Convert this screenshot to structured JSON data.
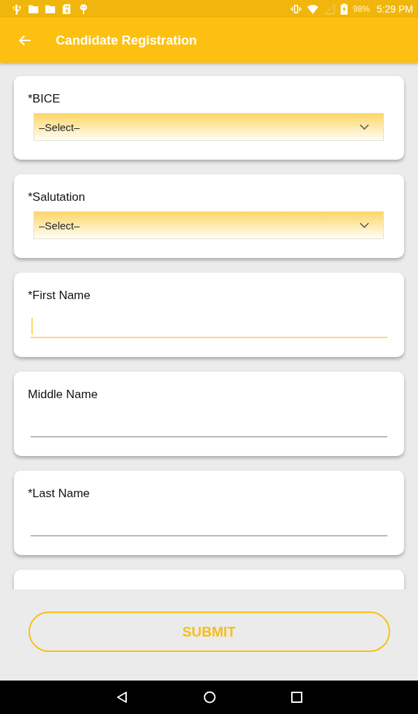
{
  "status_bar": {
    "battery": "98%",
    "time": "5:29 PM"
  },
  "app_bar": {
    "title": "Candidate Registration"
  },
  "fields": [
    {
      "kind": "select",
      "label": "*BICE",
      "value": "–Select–"
    },
    {
      "kind": "select",
      "label": "*Salutation",
      "value": "–Select–"
    },
    {
      "kind": "text",
      "label": "*First Name",
      "focused": true
    },
    {
      "kind": "text",
      "label": "Middle Name",
      "focused": false
    },
    {
      "kind": "text",
      "label": "*Last Name",
      "focused": false
    },
    {
      "kind": "clipped"
    }
  ],
  "submit_button": {
    "label": "SUBMIT"
  }
}
